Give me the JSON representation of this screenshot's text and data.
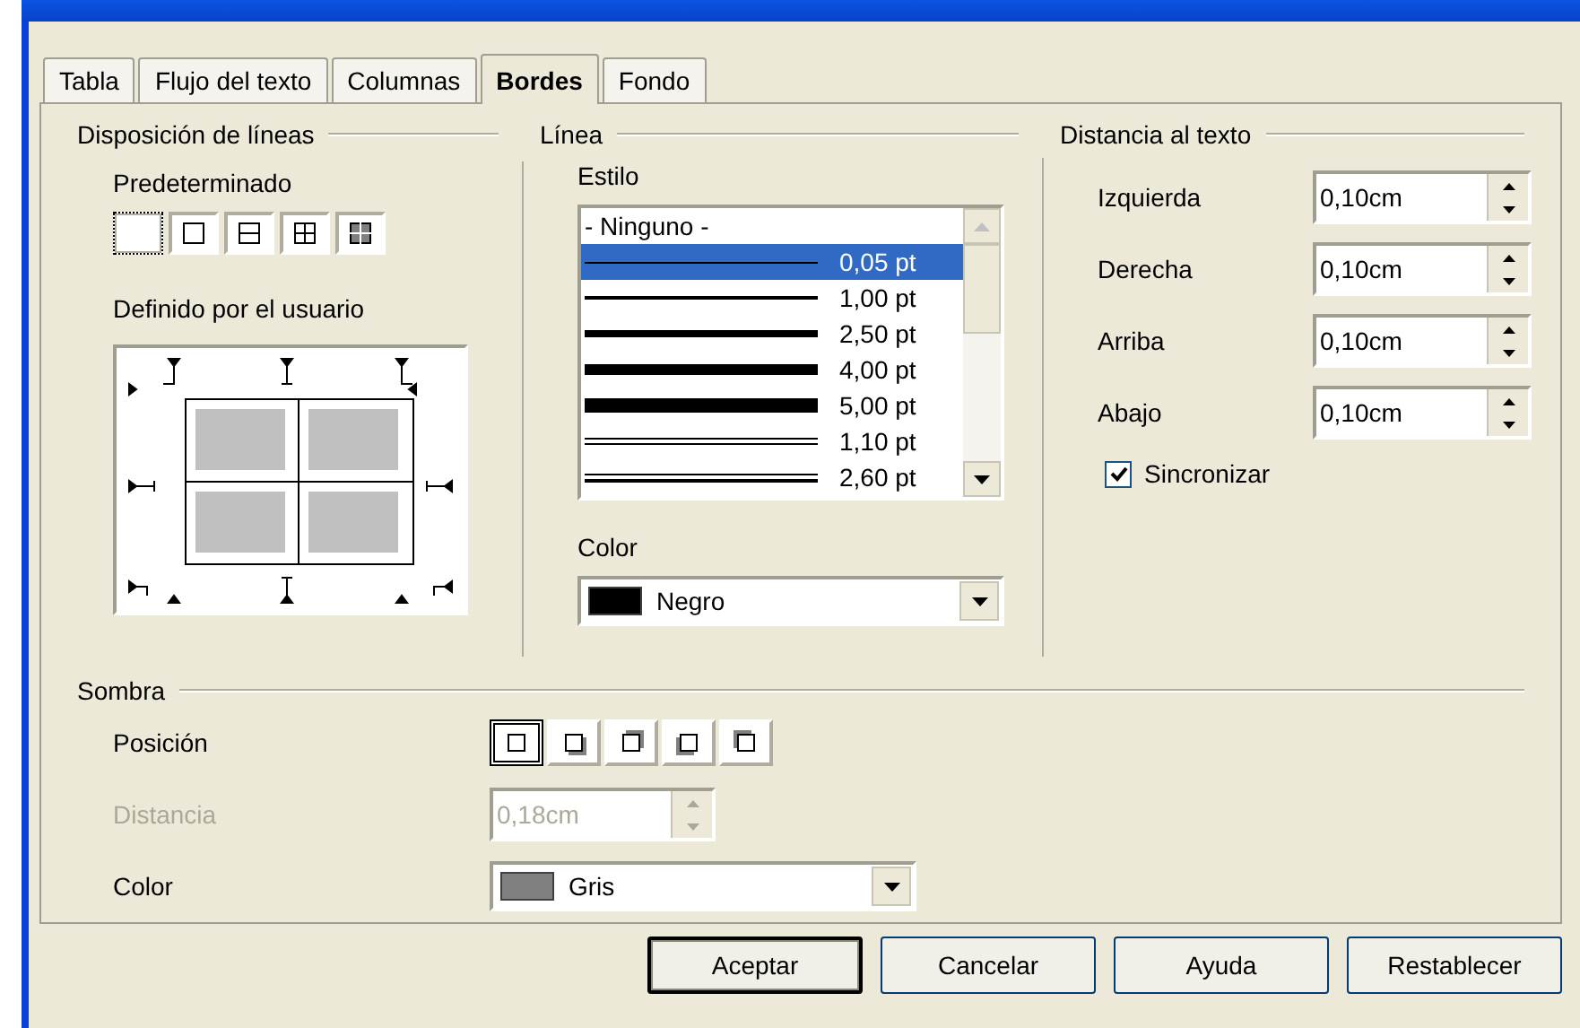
{
  "tabs": [
    {
      "label": "Tabla",
      "selected": false
    },
    {
      "label": "Flujo del texto",
      "selected": false
    },
    {
      "label": "Columnas",
      "selected": false
    },
    {
      "label": "Bordes",
      "selected": true
    },
    {
      "label": "Fondo",
      "selected": false
    }
  ],
  "line_arrangement": {
    "title": "Disposición de líneas",
    "presets_label": "Predeterminado",
    "presets": [
      {
        "kind": "none",
        "selected": true
      },
      {
        "kind": "outer",
        "selected": false
      },
      {
        "kind": "outer-horizontal",
        "selected": false
      },
      {
        "kind": "outer-all",
        "selected": false
      },
      {
        "kind": "outer-only-inner",
        "selected": false
      }
    ],
    "user_defined_label": "Definido por el usuario"
  },
  "line": {
    "title": "Línea",
    "style_label": "Estilo",
    "styles": [
      {
        "kind": "none",
        "label": "- Ninguno -",
        "selected": false
      },
      {
        "kind": "hairline",
        "label": "0,05 pt",
        "selected": true
      },
      {
        "kind": "thin",
        "label": "1,00 pt",
        "selected": false
      },
      {
        "kind": "medium",
        "label": "2,50 pt",
        "selected": false
      },
      {
        "kind": "thick",
        "label": "4,00 pt",
        "selected": false
      },
      {
        "kind": "heavy",
        "label": "5,00 pt",
        "selected": false
      },
      {
        "kind": "double",
        "label": "1,10 pt",
        "selected": false
      },
      {
        "kind": "double-wide",
        "label": "2,60 pt",
        "selected": false
      }
    ],
    "color_label": "Color",
    "color": {
      "name": "Negro",
      "color": "#000000"
    }
  },
  "spacing": {
    "title": "Distancia al texto",
    "fields": [
      {
        "label": "Izquierda",
        "value": "0,10cm"
      },
      {
        "label": "Derecha",
        "value": "0,10cm"
      },
      {
        "label": "Arriba",
        "value": "0,10cm"
      },
      {
        "label": "Abajo",
        "value": "0,10cm"
      }
    ],
    "sync": {
      "label": "Sincronizar",
      "checked": true
    }
  },
  "shadow": {
    "title": "Sombra",
    "position_label": "Posición",
    "positions": [
      {
        "kind": "none",
        "selected": true
      },
      {
        "kind": "bottom-right",
        "selected": false
      },
      {
        "kind": "top-right",
        "selected": false
      },
      {
        "kind": "bottom-left",
        "selected": false
      },
      {
        "kind": "top-left",
        "selected": false
      }
    ],
    "distance": {
      "label": "Distancia",
      "value": "0,18cm",
      "disabled": true
    },
    "color_label": "Color",
    "color": {
      "name": "Gris",
      "color": "#808080"
    }
  },
  "buttons": [
    {
      "label": "Aceptar",
      "default": true
    },
    {
      "label": "Cancelar",
      "default": false
    },
    {
      "label": "Ayuda",
      "default": false
    },
    {
      "label": "Restablecer",
      "default": false
    }
  ]
}
